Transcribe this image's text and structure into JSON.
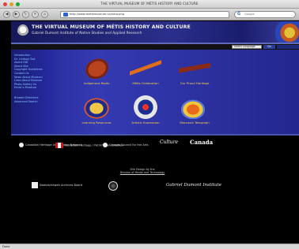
{
  "browser": {
    "window_title": "THE VIRTUAL MUSEUM OF MÉTIS HISTORY AND CULTURE",
    "url": "http://www.metismuseum.ca/intro.php",
    "search_placeholder": "Google",
    "status": "Done",
    "back_glyph": "◀",
    "forward_glyph": "▶",
    "reload_glyph": "↻",
    "stop_glyph": "✕",
    "home_glyph": "⌂",
    "search_glyph": "G"
  },
  "banner": {
    "title": "THE VIRTUAL MUSEUM OF MÉTIS HISTORY AND CULTURE",
    "subtitle": "Gabriel Dumont Institute of Native Studies and Applied Research"
  },
  "language": {
    "select_value": "Select Language",
    "go_label": "Go"
  },
  "nav": {
    "items": [
      "Introduction",
      "Dr. Lindsay Tool",
      "About GDI",
      "About Site",
      "Copyright Guidelines",
      "Contact Us",
      "News About Museum",
      "Links About Museum",
      "Photo Gallery Us",
      "Email a Museum"
    ],
    "footer_items": [
      "Browse Directions",
      "Advanced Search"
    ]
  },
  "tiles": [
    {
      "label": "Indigenous Roots",
      "icon": "violin-icon"
    },
    {
      "label": "Métis Celebration",
      "icon": "fiddle-bow-icon"
    },
    {
      "label": "Our Proud Heritage",
      "icon": "pipe-icon"
    },
    {
      "label": "Learning Resources",
      "icon": "beaver-icon"
    },
    {
      "label": "Artistic Expression",
      "icon": "medallion-icon"
    },
    {
      "label": "Moccasin Telegraph",
      "icon": "beaded-bag-icon"
    }
  ],
  "partners": {
    "p1": "Canadian Heritage Information Network",
    "p2": "Canadian Heritage / Patrimoine canadien",
    "p3": "Canada Council for the Arts",
    "p4": "Culture",
    "p5": "Canada",
    "p6": "Saskatchewan Archives Board",
    "signature": "Gabriel Dumont Institute"
  },
  "design_credit": {
    "line1": "Site Design by the",
    "link": "Division of Media and Technology"
  },
  "colors": {
    "banner": "#2b2f8c",
    "main_bg": "#343ab2",
    "nav_link": "#8cc6ff",
    "tile_label": "#ffd24a"
  }
}
